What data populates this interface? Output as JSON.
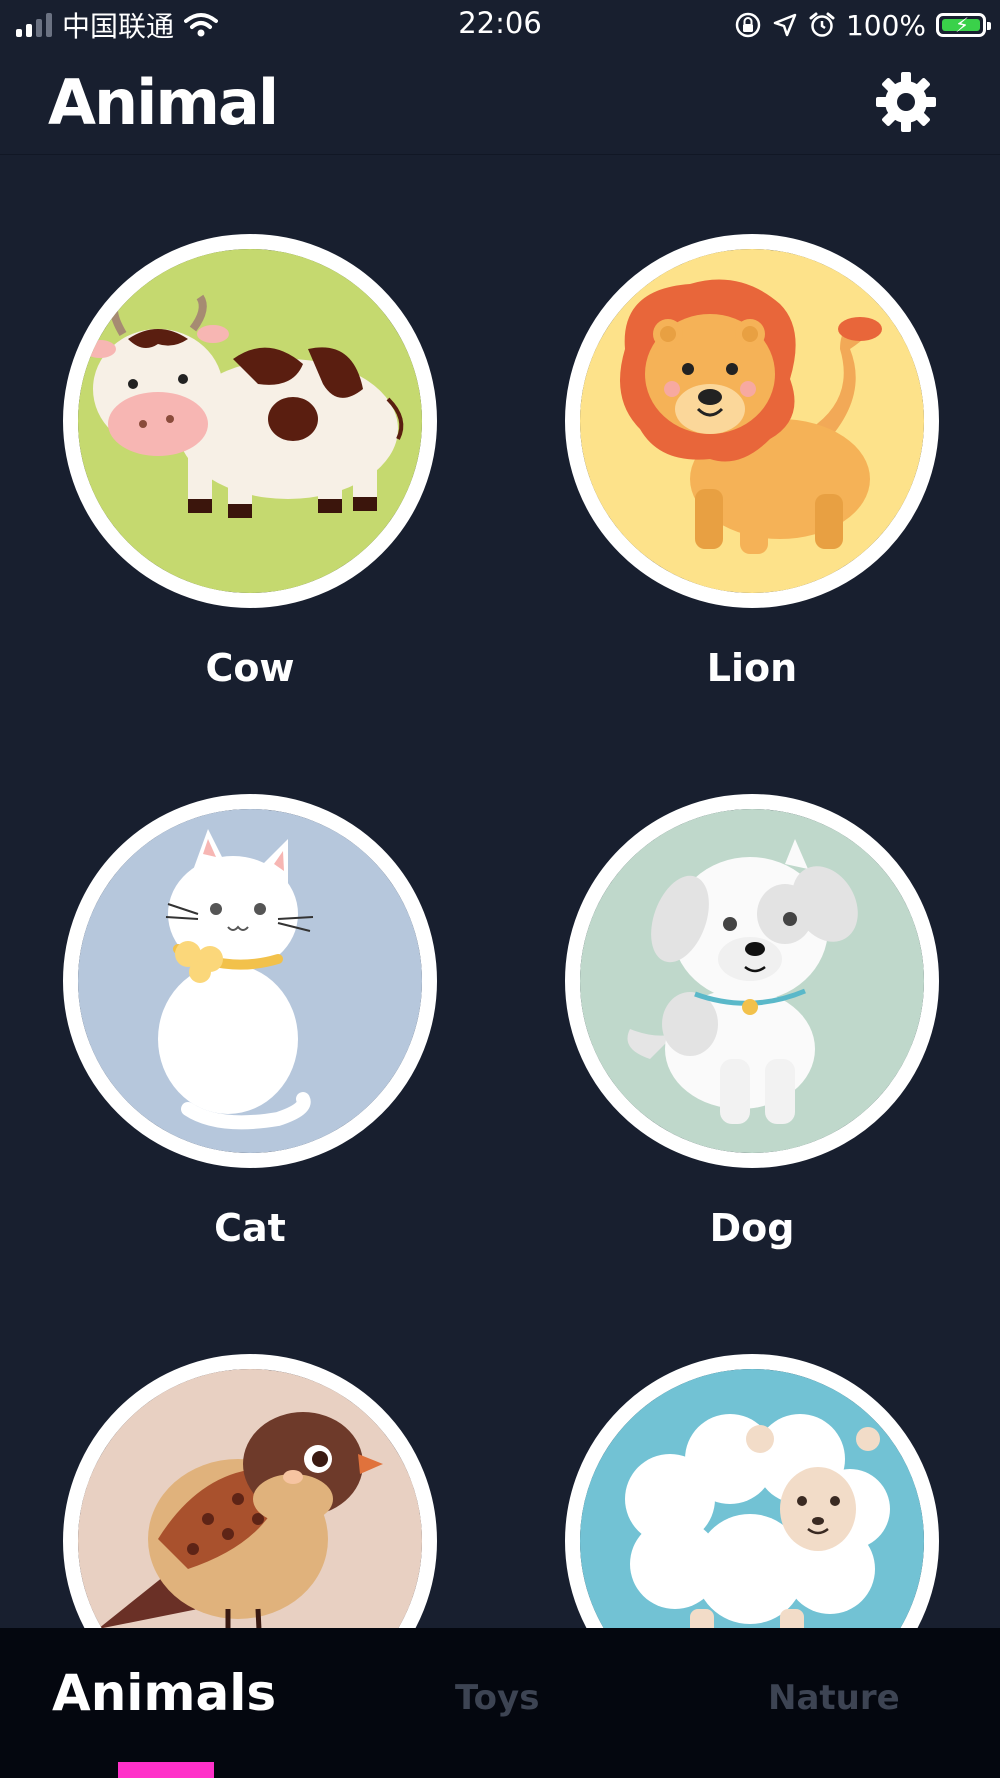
{
  "status_bar": {
    "carrier": "中国联通",
    "time": "22:06",
    "battery": "100%"
  },
  "header": {
    "title": "Animal",
    "settings_icon": "gear-icon"
  },
  "animals": [
    {
      "label": "Cow",
      "bg": "#c5d96f"
    },
    {
      "label": "Lion",
      "bg": "#fde28a"
    },
    {
      "label": "Cat",
      "bg": "#b6c7dc"
    },
    {
      "label": "Dog",
      "bg": "#bfd8cb"
    },
    {
      "label": "",
      "bg": "#e8d0c2"
    },
    {
      "label": "",
      "bg": "#72c2d4"
    }
  ],
  "tabs": [
    {
      "label": "Animals",
      "active": true
    },
    {
      "label": "Toys",
      "active": false
    },
    {
      "label": "Nature",
      "active": false
    }
  ],
  "colors": {
    "background": "#181f2f",
    "tabbar": "#04070f",
    "accent": "#ff31c9",
    "inactive_tab": "#3d4453"
  }
}
